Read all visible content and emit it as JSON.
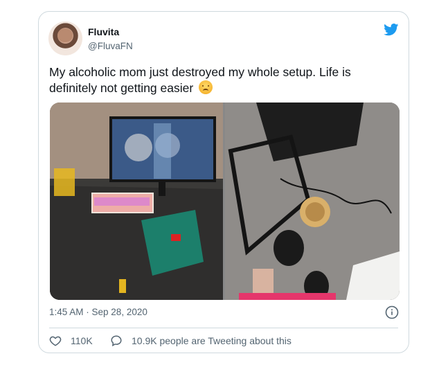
{
  "tweet": {
    "author_name": "Fluvita",
    "author_handle": "@FluvaFN",
    "text": "My alcoholic mom just destroyed my whole setup. Life is definitely not getting easier",
    "emoji": "disappointed-face",
    "timestamp": "1:45 AM · Sep 28, 2020",
    "likes_count": "110K",
    "conversation_text": "10.9K people are Tweeting about this",
    "brand_color": "#1d9bf0",
    "muted_color": "#536471"
  },
  "media": {
    "photos": [
      {
        "subject": "desk-setup"
      },
      {
        "subject": "damaged-pc-on-floor"
      }
    ]
  }
}
